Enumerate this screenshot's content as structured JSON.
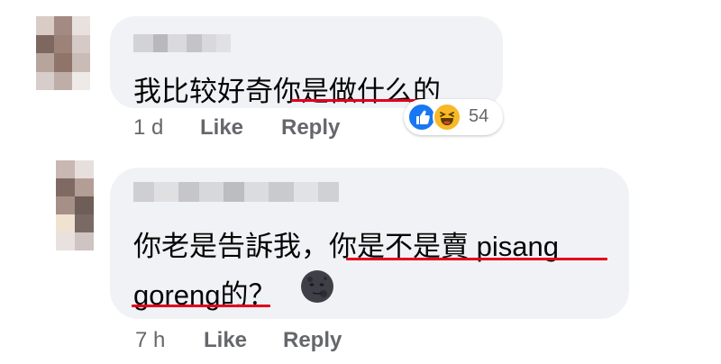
{
  "comments": [
    {
      "text": "我比较好奇你是做什么的",
      "time": "1 d",
      "like_label": "Like",
      "reply_label": "Reply",
      "reactions": {
        "icons": [
          "like-icon",
          "haha-icon"
        ],
        "count": "54"
      }
    },
    {
      "text_line1": "你老是告訴我，你是不是賣 pisang",
      "text_line2": "goreng的？",
      "emoji": "new-moon-face-icon",
      "time": "7 h",
      "like_label": "Like",
      "reply_label": "Reply"
    }
  ],
  "colors": {
    "bubble": "#f0f2f5",
    "underline": "#e3001b",
    "meta_text": "#65676b",
    "like_blue": "#1877f2",
    "haha_yellow": "#f7b928"
  }
}
